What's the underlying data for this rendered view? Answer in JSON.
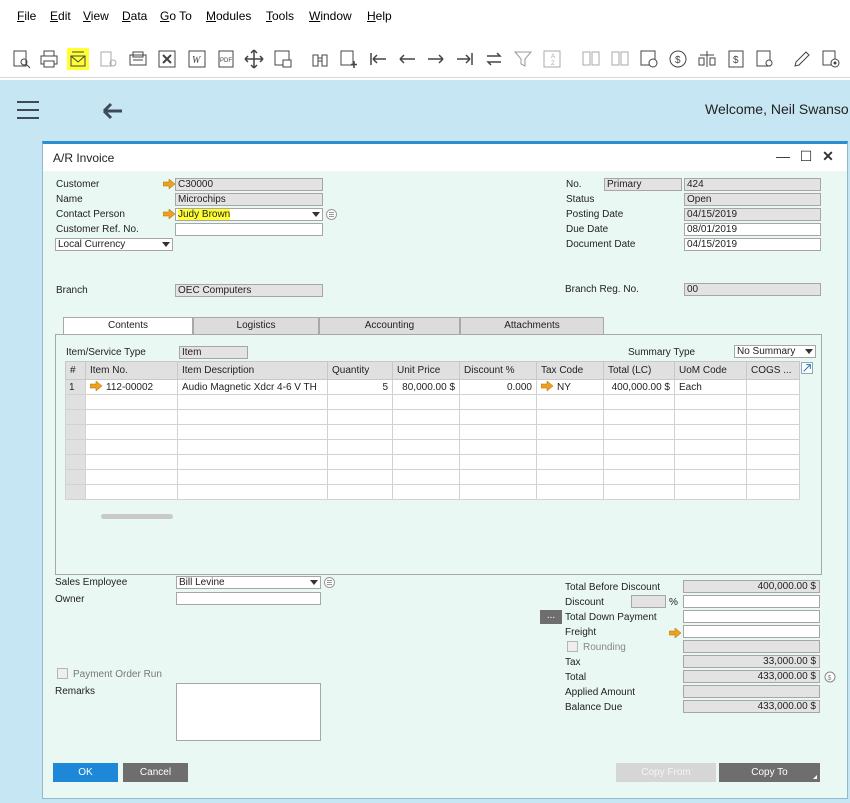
{
  "menu": [
    "File",
    "Edit",
    "View",
    "Data",
    "Go To",
    "Modules",
    "Tools",
    "Window",
    "Help"
  ],
  "toolbar_icons": [
    "preview-icon",
    "print-icon",
    "email-icon",
    "sms-icon",
    "fax-icon",
    "excel-icon",
    "word-icon",
    "pdf-icon",
    "move-icon",
    "lock-icon",
    "binoculars-icon",
    "add-icon",
    "first-record-icon",
    "previous-record-icon",
    "next-record-icon",
    "last-record-icon",
    "refresh-icon",
    "filter-icon",
    "sort-icon",
    "base-document-icon",
    "target-document-icon",
    "payment-icon",
    "currency-icon",
    "balance-icon",
    "journal-icon",
    "price-list-icon",
    "edit-icon",
    "settings-icon"
  ],
  "header": {
    "welcome": "Welcome, Neil Swanso"
  },
  "window": {
    "title": "A/R Invoice"
  },
  "left_fields": {
    "customer_label": "Customer",
    "customer": "C30000",
    "name_label": "Name",
    "name": "Microchips",
    "contact_label": "Contact Person",
    "contact": "Judy Brown",
    "ref_label": "Customer Ref. No.",
    "ref": "",
    "currency": "Local Currency",
    "branch_label": "Branch",
    "branch": "OEC Computers"
  },
  "right_fields": {
    "no_label": "No.",
    "series": "Primary",
    "number": "424",
    "status_label": "Status",
    "status": "Open",
    "posting_label": "Posting Date",
    "posting": "04/15/2019",
    "due_label": "Due Date",
    "due": "08/01/2019",
    "docdate_label": "Document Date",
    "docdate": "04/15/2019",
    "branch_reg_label": "Branch Reg. No.",
    "branch_reg": "00"
  },
  "tabs": [
    "Contents",
    "Logistics",
    "Accounting",
    "Attachments"
  ],
  "contents": {
    "item_type_label": "Item/Service Type",
    "item_type": "Item",
    "summary_type_label": "Summary Type",
    "summary_type": "No Summary",
    "columns": [
      "#",
      "Item No.",
      "Item Description",
      "Quantity",
      "Unit Price",
      "Discount %",
      "Tax Code",
      "Total (LC)",
      "UoM Code",
      "COGS ..."
    ],
    "row": {
      "n": "1",
      "item_no": "112-00002",
      "desc": "Audio Magnetic Xdcr 4-6 V TH",
      "qty": "5",
      "price": "80,000.00 $",
      "discount": "0.000",
      "tax": "NY",
      "total": "400,000.00 $",
      "uom": "Each",
      "cogs": ""
    }
  },
  "bottom_left": {
    "sales_employee_label": "Sales Employee",
    "sales_employee": "Bill Levine",
    "owner_label": "Owner",
    "owner": "",
    "payment_order_label": "Payment Order Run",
    "remarks_label": "Remarks"
  },
  "totals": {
    "before_discount_label": "Total Before Discount",
    "before_discount": "400,000.00 $",
    "discount_label": "Discount",
    "percent": "%",
    "down_payment_button": "...",
    "down_payment_label": "Total Down Payment",
    "freight_label": "Freight",
    "rounding_label": "Rounding",
    "tax_label": "Tax",
    "tax": "33,000.00 $",
    "total_label": "Total",
    "total": "433,000.00 $",
    "applied_label": "Applied Amount",
    "balance_label": "Balance Due",
    "balance": "433,000.00 $"
  },
  "buttons": {
    "ok": "OK",
    "cancel": "Cancel",
    "copy_from": "Copy From",
    "copy_to": "Copy To"
  },
  "colors": {
    "accent": "#2a8ed0",
    "highlight": "#ffff33",
    "ok_button": "#1e88d8",
    "cancel_button": "#6e6e6e",
    "header_band": "#c7e6f3",
    "form_background": "#eaf8f4"
  }
}
